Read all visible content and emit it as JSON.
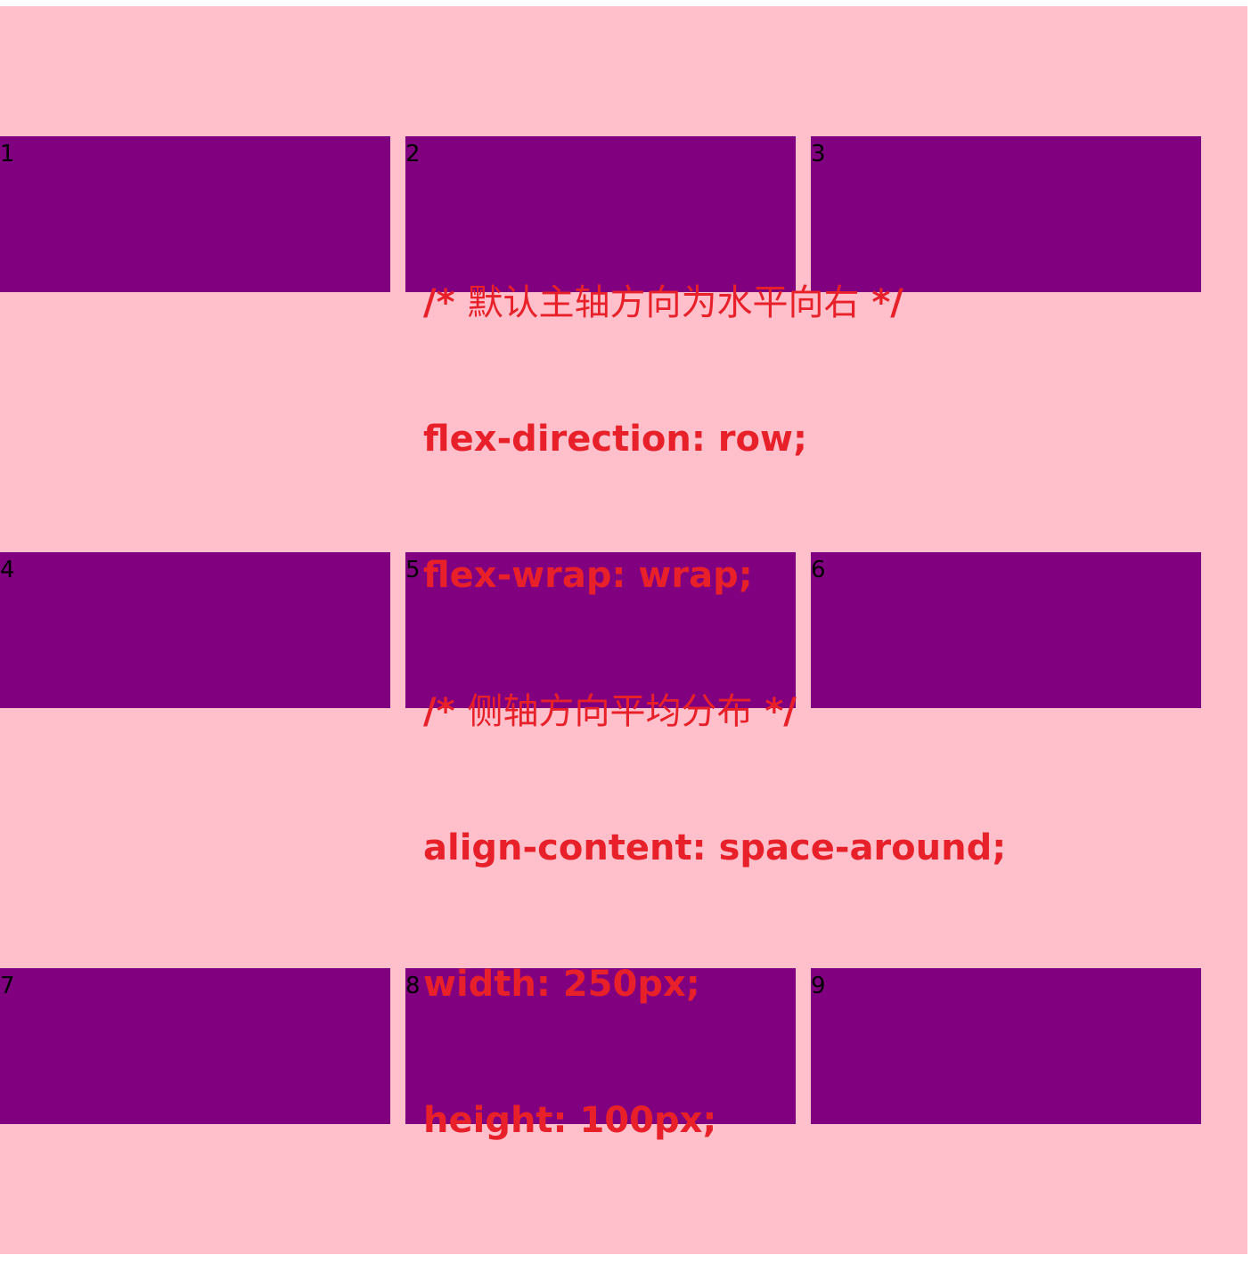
{
  "colors": {
    "page_background": "#ffffff",
    "container_background": "#ffc0cb",
    "item_background": "#800080",
    "item_text": "#000000",
    "code_text": "#e8202a"
  },
  "items": [
    {
      "label": "1"
    },
    {
      "label": "2"
    },
    {
      "label": "3"
    },
    {
      "label": "4"
    },
    {
      "label": "5"
    },
    {
      "label": "6"
    },
    {
      "label": "7"
    },
    {
      "label": "8"
    },
    {
      "label": "9"
    }
  ],
  "code_note": {
    "lines": [
      {
        "type": "comment",
        "open": "/* ",
        "text": "默认主轴方向为水平向右",
        "close": " */"
      },
      {
        "type": "code",
        "text": "flex-direction: row;"
      },
      {
        "type": "code",
        "text": "flex-wrap: wrap;"
      },
      {
        "type": "comment",
        "open": "/* ",
        "text": "侧轴方向平均分布",
        "close": " */"
      },
      {
        "type": "code",
        "text": "align-content: space-around;"
      },
      {
        "type": "code",
        "text": "width: 250px;"
      },
      {
        "type": "code",
        "text": "height: 100px;"
      }
    ]
  }
}
